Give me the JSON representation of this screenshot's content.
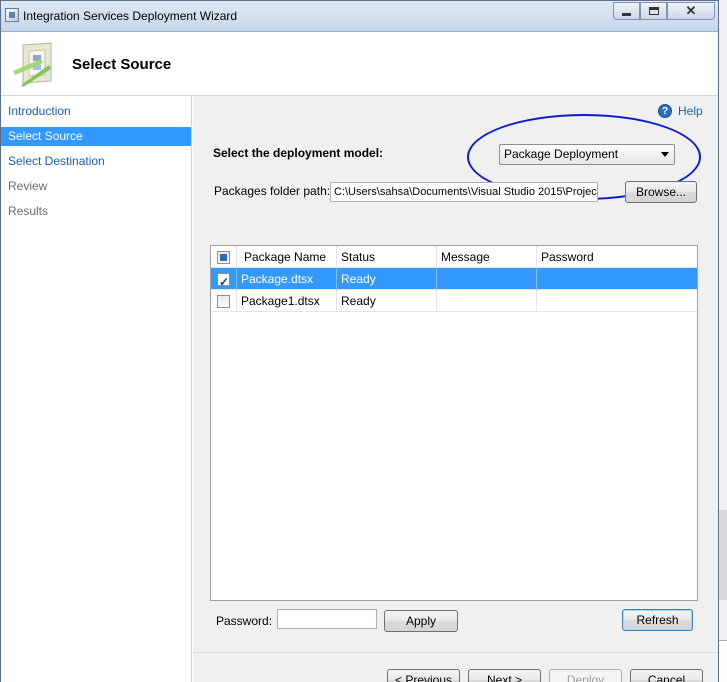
{
  "window": {
    "title": "Integration Services Deployment Wizard",
    "close_glyph": "✕"
  },
  "header": {
    "page_title": "Select Source"
  },
  "sidebar": {
    "items": [
      {
        "label": "Introduction",
        "state": "normal"
      },
      {
        "label": "Select Source",
        "state": "selected"
      },
      {
        "label": "Select Destination",
        "state": "normal"
      },
      {
        "label": "Review",
        "state": "disabled"
      },
      {
        "label": "Results",
        "state": "disabled"
      }
    ]
  },
  "main": {
    "help_icon_glyph": "?",
    "help_label": "Help",
    "deployment_model_label": "Select the deployment model:",
    "deployment_model_value": "Package Deployment",
    "folder_label": "Packages folder path:",
    "folder_value": "C:\\Users\\sahsa\\Documents\\Visual Studio 2015\\Projec",
    "browse_label": "Browse...",
    "grid": {
      "columns": [
        "Package Name",
        "Status",
        "Message",
        "Password"
      ],
      "rows": [
        {
          "checked": true,
          "selected": true,
          "name": "Package.dtsx",
          "status": "Ready",
          "message": "",
          "password": ""
        },
        {
          "checked": false,
          "selected": false,
          "name": "Package1.dtsx",
          "status": "Ready",
          "message": "",
          "password": ""
        }
      ]
    },
    "password_label": "Password:",
    "password_value": "",
    "apply_label": "Apply",
    "refresh_label": "Refresh"
  },
  "footer": {
    "previous_label": "< Previous",
    "next_label": "Next >",
    "deploy_label": "Deploy",
    "cancel_label": "Cancel"
  },
  "colors": {
    "selection": "#3399ff",
    "link": "#1f5ea8",
    "annotation_ellipse": "#0a1ad0"
  }
}
